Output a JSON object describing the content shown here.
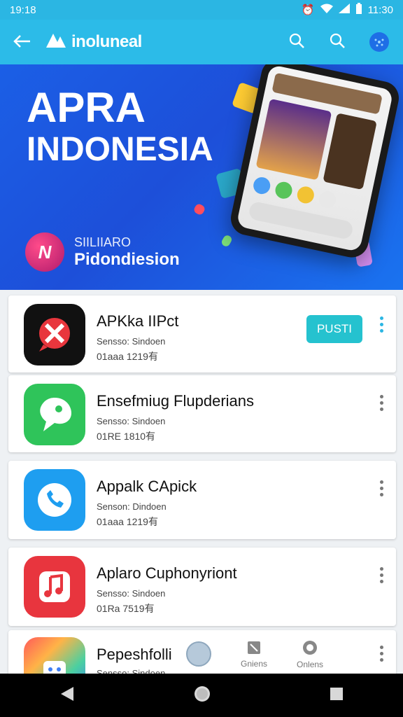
{
  "status_bar": {
    "time_left": "19:18",
    "time_right": "11:30"
  },
  "app_bar": {
    "brand": "inoluneal"
  },
  "hero": {
    "title_line1": "APRA",
    "title_line2": "INDONESIA",
    "sub_small": "SIILIIARO",
    "sub_large": "Pidondiesion",
    "logo_letter": "N"
  },
  "apps": [
    {
      "title": "APKka IIPct",
      "meta1": "Sensso: Sindoen",
      "meta2": "01aaa  1219有",
      "button": "PUSTI",
      "icon_bg": "#111111"
    },
    {
      "title": "Ensefmiug Flupderians",
      "meta1": "Sensso: Sindoen",
      "meta2": "01RE  1810有",
      "icon_bg": "#2fc45a"
    },
    {
      "title": "Appalk CApick",
      "meta1": "Senson: Dindoen",
      "meta2": "01aaa  1219有",
      "icon_bg": "#1e9ef0"
    },
    {
      "title": "Aplaro Cuphonyriont",
      "meta1": "Sensso: Sindoen",
      "meta2": "01Ra  7519有",
      "icon_bg": "#e8353e"
    },
    {
      "title": "Pepeshfolli",
      "meta1": "Sensso: Sindoen",
      "meta2": "",
      "icon_bg": "#e94b5c"
    }
  ],
  "bottom_tabs": [
    {
      "label": "Gniens",
      "icon": "box-icon"
    },
    {
      "label": "Onlens",
      "icon": "circle-icon"
    }
  ],
  "nav": {
    "back": "◀",
    "home": "●",
    "recents": "■"
  }
}
